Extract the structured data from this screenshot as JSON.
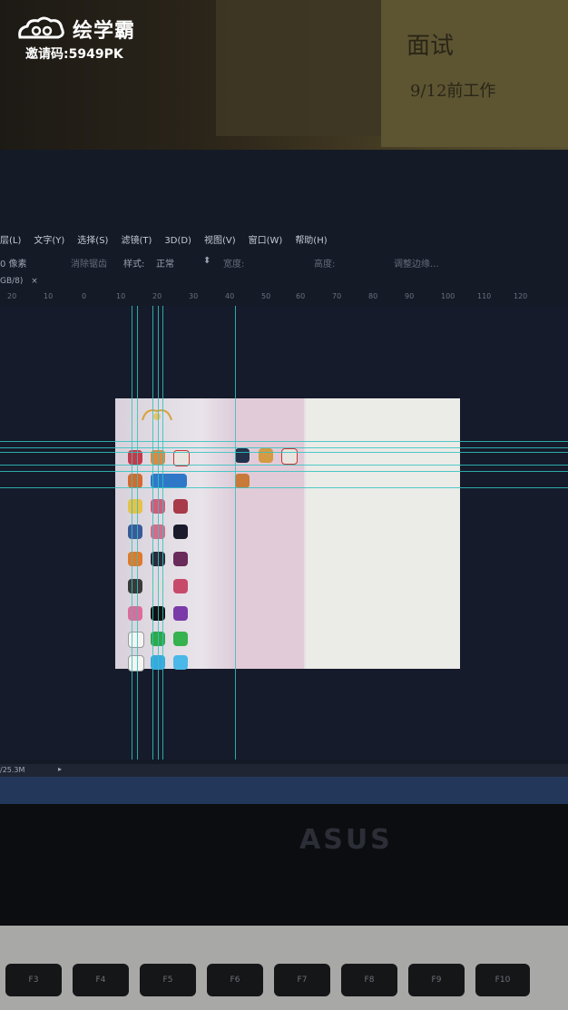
{
  "overlay": {
    "brand_name": "绘学霸",
    "invite_label": "邀请码:",
    "invite_code": "5949PK"
  },
  "photoshop": {
    "menu": [
      "层(L)",
      "文字(Y)",
      "选择(S)",
      "滤镜(T)",
      "3D(D)",
      "视图(V)",
      "窗口(W)",
      "帮助(H)"
    ],
    "options": {
      "feather_value": "0 像素",
      "antialias": "消除锯齿",
      "style_label": "样式:",
      "style_value": "正常",
      "width_label": "宽度:",
      "height_label": "高度:",
      "refine_edge": "调整边缘..."
    },
    "doc_tab": "GB/8)",
    "ruler_marks": [
      "20",
      "10",
      "0",
      "10",
      "20",
      "30",
      "40",
      "50",
      "60",
      "70",
      "80",
      "90",
      "100",
      "110",
      "120"
    ],
    "status": "/25.3M"
  },
  "handwriting": {
    "line1": "面试",
    "line2": "9/12前工作"
  },
  "keyboard": {
    "brand": "ASUS",
    "fkeys": [
      "F3",
      "F4",
      "F5",
      "F6",
      "F7",
      "F8",
      "F9",
      "F10"
    ]
  },
  "colors": {
    "guide": "#31c3c0",
    "bezel": "#22375a"
  }
}
